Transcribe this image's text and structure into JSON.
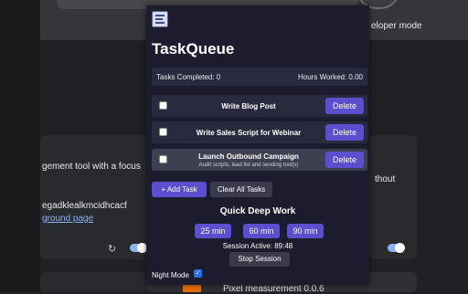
{
  "background": {
    "dev_mode_label": "eloper mode",
    "card_text_1": "gement tool with a focus",
    "card_text_2": "egadklealkmcidhcacf",
    "card_link": "ground page",
    "right_card_text": "thout",
    "bottom_ext_name": "Pixel measurement  0.0.6",
    "reload_icon": "reload-icon"
  },
  "popup": {
    "app_title": "TaskQueue",
    "stats": {
      "tasks_completed": "Tasks Completed: 0",
      "hours_worked": "Hours Worked: 0.00"
    },
    "tasks": [
      {
        "title": "Write Blog Post",
        "subtitle": "",
        "delete_label": "Delete",
        "checked": false
      },
      {
        "title": "Write Sales Script for Webinar",
        "subtitle": "",
        "delete_label": "Delete",
        "checked": false
      },
      {
        "title": "Launch Outbound Campaign",
        "subtitle": "Audit scripts, lead list and sending tool(s)",
        "delete_label": "Delete",
        "checked": false
      }
    ],
    "add_task_label": "+ Add Task",
    "clear_all_label": "Clear All Tasks",
    "deep_work_title": "Quick Deep Work",
    "durations": [
      "25 min",
      "60 min",
      "90 min"
    ],
    "session_status": "Session Active: 89:48",
    "stop_session_label": "Stop Session",
    "night_mode_label": "Night Mode",
    "night_mode_checked": true,
    "checkmark": "✓"
  },
  "colors": {
    "popup_bg": "#1c1c2e",
    "accent": "#5b4fcf",
    "panel": "#2a2a3e"
  }
}
